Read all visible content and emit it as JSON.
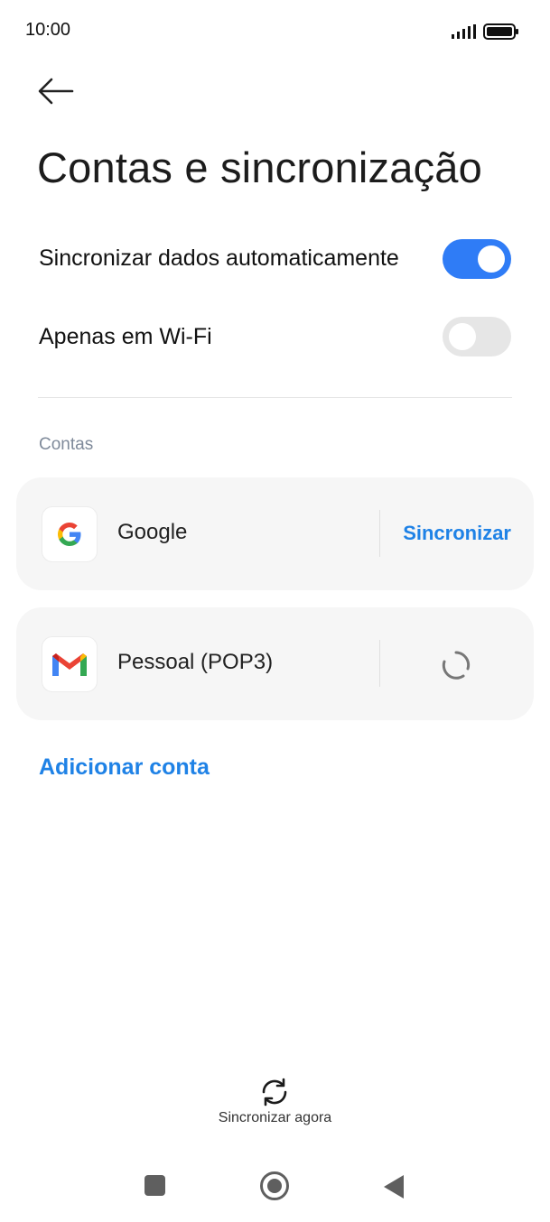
{
  "status_bar": {
    "time": "10:00",
    "icons": [
      "signal-icon",
      "battery-icon"
    ]
  },
  "header": {
    "back_icon": "arrow-left-icon",
    "title": "Contas e sincronização"
  },
  "settings": {
    "auto_sync": {
      "label": "Sincronizar dados automaticamente",
      "enabled": true
    },
    "wifi_only": {
      "label": "Apenas em Wi-Fi",
      "enabled": false
    }
  },
  "accounts": {
    "section_label": "Contas",
    "items": [
      {
        "name": "Google",
        "icon": "google-icon",
        "action": "Sincronizar"
      },
      {
        "name": "Pessoal (POP3)",
        "icon": "gmail-icon",
        "action_icon": "sync-spinner-icon"
      }
    ],
    "add_label": "Adicionar conta"
  },
  "footer": {
    "sync_now_label": "Sincronizar agora",
    "sync_now_icon": "sync-icon"
  },
  "nav_bar": {
    "icons": [
      "recents-square-icon",
      "home-circle-icon",
      "back-triangle-icon"
    ]
  },
  "colors": {
    "accent": "#1f82e6",
    "toggle_on": "#2f7cf6",
    "toggle_off": "#e6e6e6",
    "card_bg": "#f6f6f6",
    "section_label": "#7f8a9a"
  }
}
